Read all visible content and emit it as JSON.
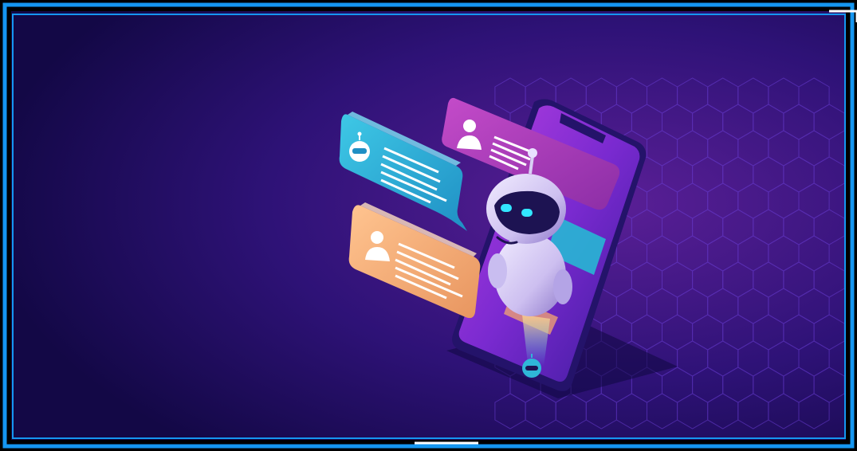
{
  "colors": {
    "background_deep": "#160a52",
    "background_purple": "#4a1a86",
    "border_blue": "#1596f0",
    "bubble_cyan": "#30b3d6",
    "bubble_magenta": "#b03cb8",
    "bubble_orange": "#f3ad79",
    "robot_body": "#d6cdf0",
    "robot_visor": "#1d1352",
    "robot_eyes": "#32e6ff",
    "phone_screen": "#8a2fc7",
    "hex_grid": "#6b3fd6"
  },
  "icons": {
    "top_bubble": "user-icon",
    "left_bubble": "robot-icon",
    "bottom_bubble": "user-icon",
    "phone_bottom": "robot-icon"
  }
}
